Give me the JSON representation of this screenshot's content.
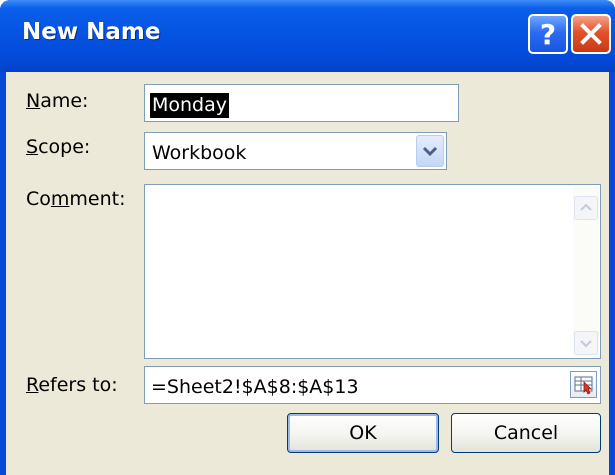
{
  "window": {
    "title": "New Name",
    "help_glyph": "?",
    "close_glyph": "close"
  },
  "form": {
    "name": {
      "label_key": "N",
      "label_rest": "ame:",
      "value": "Monday"
    },
    "scope": {
      "label_key": "S",
      "label_rest": "cope:",
      "value": "Workbook"
    },
    "comment": {
      "label_pre": "Co",
      "label_key": "m",
      "label_rest": "ment:",
      "value": ""
    },
    "refers_to": {
      "label_key": "R",
      "label_rest": "efers to:",
      "value": "=Sheet2!$A$8:$A$13"
    }
  },
  "buttons": {
    "ok": "OK",
    "cancel": "Cancel"
  },
  "colors": {
    "titlebar": "#0553e2",
    "dialog_bg": "#ece9d8",
    "close_button": "#e2532b",
    "selection_bg": "#000000"
  },
  "icons": {
    "help": "help-icon",
    "close": "close-icon",
    "dropdown": "chevron-down-icon",
    "scroll_up": "scroll-up-icon",
    "scroll_down": "scroll-down-icon",
    "collapse": "collapse-dialog-icon"
  }
}
